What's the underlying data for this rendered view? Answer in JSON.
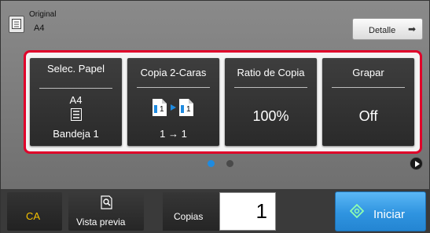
{
  "original": {
    "title": "Original",
    "size": "A4",
    "icon": "original-document-icon"
  },
  "detail": {
    "label": "Detalle",
    "icon": "arrow-right-icon"
  },
  "tiles": [
    {
      "title": "Selec. Papel",
      "value": "A4",
      "sub": "Bandeja 1",
      "icon": "paper-tray-icon"
    },
    {
      "title": "Copia 2-Caras",
      "value": "1 → 1",
      "icon": "duplex-copy-icon"
    },
    {
      "title": "Ratio de Copia",
      "value": "100%"
    },
    {
      "title": "Grapar",
      "value": "Off"
    }
  ],
  "pager": {
    "pages": 2,
    "current": 1,
    "active_color": "#1f8be0",
    "inactive_color": "#4a4a4a"
  },
  "panel": {
    "highlight_color": "#e0002a"
  },
  "bottom": {
    "ca_label": "CA",
    "preview_label": "Vista previa",
    "preview_icon": "preview-magnifier-icon",
    "copies_label": "Copias",
    "copies_value": "1",
    "start_label": "Iniciar",
    "start_icon": "start-diamond-icon",
    "start_color": "#2f94e0"
  }
}
